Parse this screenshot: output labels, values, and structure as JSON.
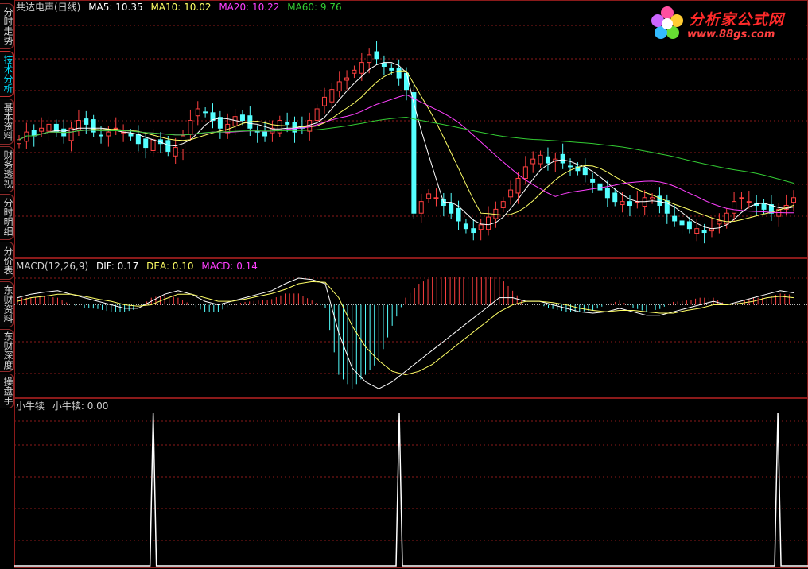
{
  "sidebar": {
    "tabs": [
      {
        "label": "分时走势",
        "active": false
      },
      {
        "label": "技术分析",
        "active": true
      },
      {
        "label": "基本资料",
        "active": false
      },
      {
        "label": "财务透视",
        "active": false
      },
      {
        "label": "分时明细",
        "active": false
      },
      {
        "label": "分价表",
        "active": false
      },
      {
        "label": "东财资料",
        "active": false
      },
      {
        "label": "东财深度",
        "active": false
      },
      {
        "label": "操盘手",
        "active": false
      }
    ]
  },
  "logo": {
    "title": "分析家公式网",
    "url": "www.88gs.com"
  },
  "main_panel": {
    "stock_name": "共达电声(日线)",
    "ma5": "MA5: 10.35",
    "ma10": "MA10: 10.02",
    "ma20": "MA20: 10.22",
    "ma60": "MA60: 9.76"
  },
  "macd_panel": {
    "name": "MACD(12,26,9)",
    "dif": "DIF: 0.17",
    "dea": "DEA: 0.10",
    "macd": "MACD: 0.14"
  },
  "indicator_panel": {
    "name": "小牛犊",
    "value": "小牛犊: 0.00"
  },
  "colors": {
    "up": "#ff4040",
    "down": "#54ffff",
    "ma5": "#ffffff",
    "ma10": "#ffff66",
    "ma20": "#ff40ff",
    "ma60": "#33cc33",
    "grid": "#8b1a1a",
    "text": "#d0d0d0"
  },
  "chart_data": {
    "type": "candlestick",
    "price_ylim": [
      7.6,
      13.4
    ],
    "close": [
      10.4,
      10.6,
      10.5,
      10.7,
      10.8,
      10.6,
      10.5,
      10.7,
      10.9,
      10.8,
      10.6,
      10.5,
      10.6,
      10.7,
      10.6,
      10.5,
      10.3,
      10.2,
      10.4,
      10.3,
      10.1,
      10.2,
      10.5,
      10.9,
      11.2,
      11.1,
      10.9,
      10.7,
      10.8,
      11.0,
      10.9,
      10.7,
      10.6,
      10.5,
      10.7,
      10.9,
      10.8,
      10.6,
      10.7,
      10.9,
      11.2,
      11.5,
      11.7,
      11.9,
      12.0,
      12.2,
      12.4,
      12.6,
      12.5,
      12.3,
      12.2,
      12.0,
      11.7,
      8.5,
      8.8,
      9.0,
      8.9,
      8.7,
      8.5,
      8.3,
      8.1,
      8.0,
      8.2,
      8.4,
      8.6,
      8.8,
      9.1,
      9.4,
      9.7,
      9.9,
      10.0,
      9.8,
      9.9,
      9.8,
      9.7,
      9.6,
      9.5,
      9.3,
      9.1,
      8.9,
      8.8,
      8.8,
      8.7,
      8.8,
      8.9,
      8.9,
      8.7,
      8.5,
      8.3,
      8.2,
      8.1,
      8.1,
      8.0,
      8.1,
      8.3,
      8.5,
      8.8,
      8.9,
      8.8,
      8.7,
      8.6,
      8.5,
      8.6,
      8.7,
      8.9
    ],
    "macd_ylim": [
      -1.3,
      0.55
    ],
    "dif": [
      0.1,
      0.15,
      0.18,
      0.2,
      0.15,
      0.1,
      0.05,
      0.0,
      -0.05,
      -0.05,
      0.05,
      0.15,
      0.2,
      0.15,
      0.05,
      0.0,
      0.05,
      0.1,
      0.15,
      0.2,
      0.3,
      0.38,
      0.36,
      0.3,
      -0.4,
      -0.9,
      -1.1,
      -1.2,
      -1.1,
      -0.95,
      -0.8,
      -0.65,
      -0.5,
      -0.35,
      -0.2,
      -0.05,
      0.1,
      0.1,
      0.05,
      0.05,
      0.0,
      -0.05,
      -0.1,
      -0.12,
      -0.1,
      -0.05,
      -0.1,
      -0.15,
      -0.15,
      -0.1,
      -0.05,
      0.0,
      0.05,
      0.0,
      0.05,
      0.1,
      0.15,
      0.2,
      0.17
    ],
    "dea": [
      0.05,
      0.1,
      0.12,
      0.15,
      0.15,
      0.12,
      0.08,
      0.05,
      0.0,
      -0.02,
      0.0,
      0.08,
      0.15,
      0.15,
      0.1,
      0.05,
      0.05,
      0.08,
      0.12,
      0.16,
      0.22,
      0.3,
      0.33,
      0.32,
      0.1,
      -0.3,
      -0.6,
      -0.8,
      -0.95,
      -1.0,
      -0.95,
      -0.85,
      -0.7,
      -0.55,
      -0.4,
      -0.25,
      -0.1,
      0.0,
      0.05,
      0.05,
      0.03,
      0.0,
      -0.05,
      -0.08,
      -0.1,
      -0.08,
      -0.08,
      -0.1,
      -0.12,
      -0.12,
      -0.08,
      -0.05,
      0.0,
      0.0,
      0.02,
      0.05,
      0.1,
      0.12,
      0.1
    ],
    "signal_ylim": [
      0,
      1
    ],
    "signal_spikes": [
      0.175,
      0.485,
      0.962
    ]
  }
}
